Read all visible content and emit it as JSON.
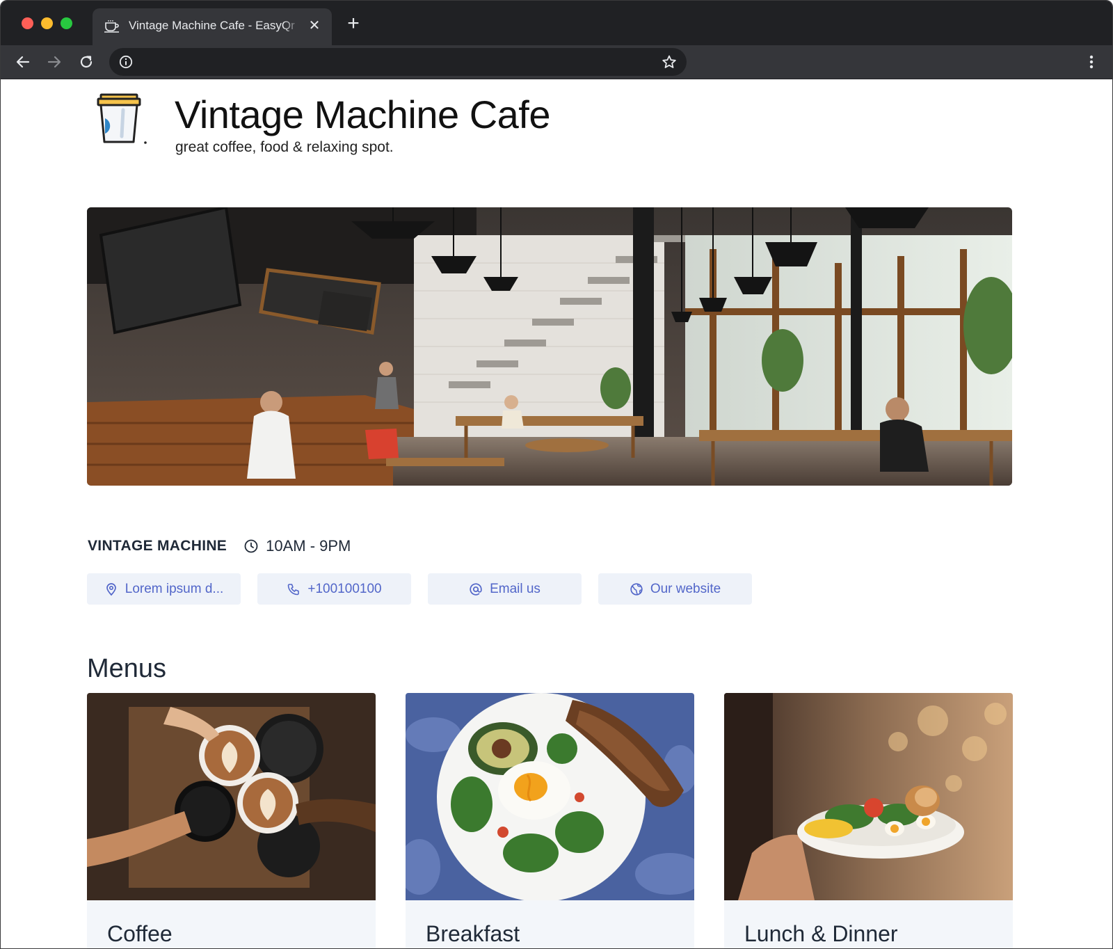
{
  "browser": {
    "tab_title": "Vintage Machine Cafe - EasyQr",
    "tab_close": "✕",
    "new_tab": "+"
  },
  "header": {
    "name": "Vintage Machine Cafe",
    "tagline": "great coffee, food & relaxing spot."
  },
  "info": {
    "business": "VINTAGE MACHINE",
    "hours": "10AM - 9PM"
  },
  "contacts": [
    {
      "label": "Lorem ipsum d...",
      "icon": "location-pin-icon"
    },
    {
      "label": "+100100100",
      "icon": "phone-icon"
    },
    {
      "label": "Email us",
      "icon": "at-sign-icon"
    },
    {
      "label": "Our website",
      "icon": "globe-icon"
    }
  ],
  "menus": {
    "title": "Menus",
    "items": [
      {
        "label": "Coffee"
      },
      {
        "label": "Breakfast"
      },
      {
        "label": "Lunch & Dinner"
      }
    ]
  },
  "colors": {
    "accent": "#5266c9",
    "chip_bg": "#eef2f9",
    "chrome_dark": "#202124",
    "chrome_tab": "#35363a"
  }
}
